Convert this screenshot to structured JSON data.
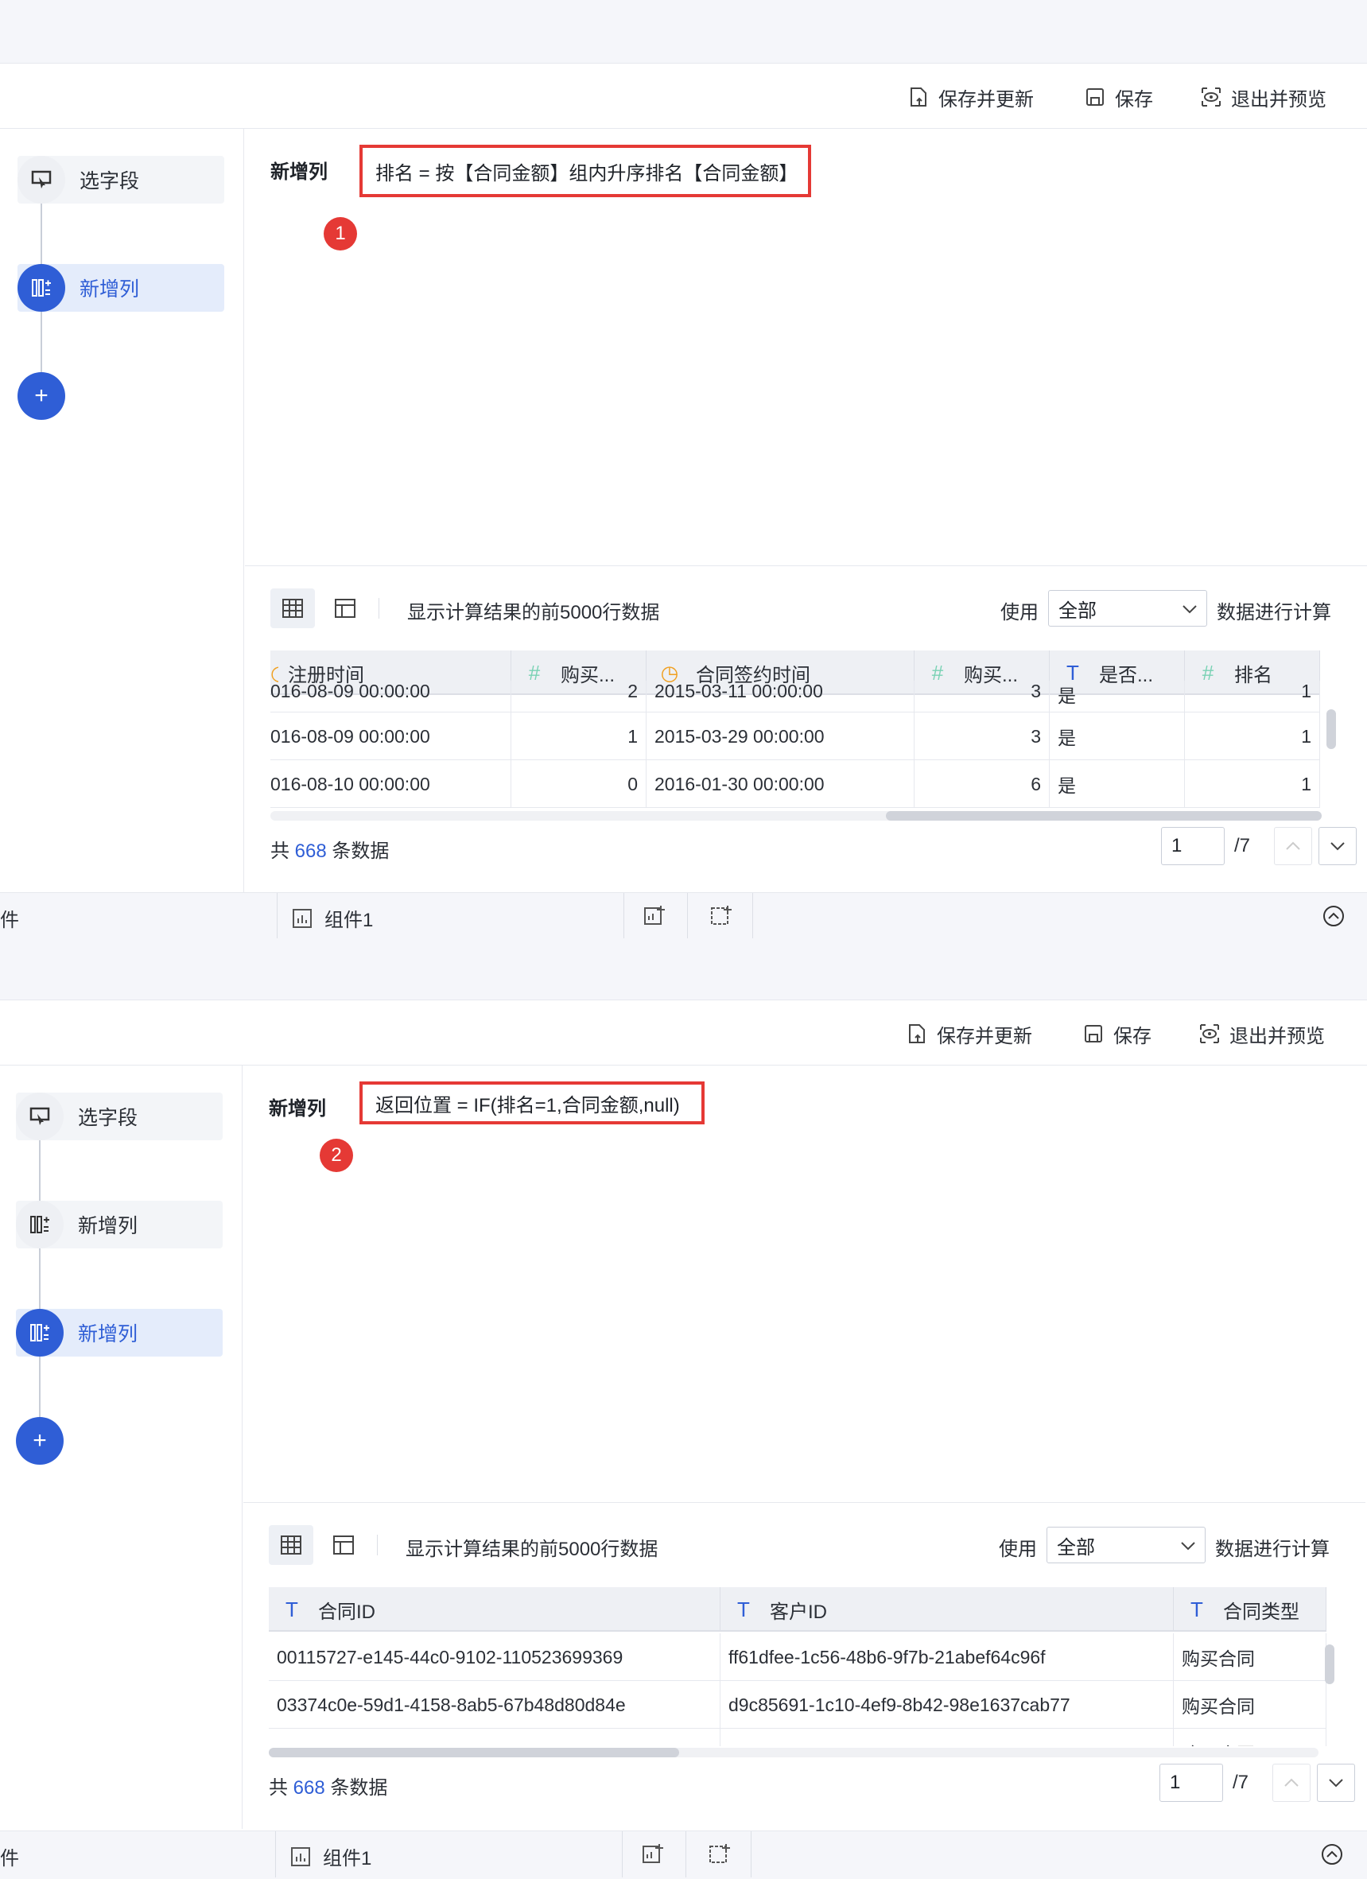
{
  "toolbar": {
    "save_update": "保存并更新",
    "save": "保存",
    "exit_preview": "退出并预览"
  },
  "steps": {
    "select_field": "选字段",
    "add_column": "新增列"
  },
  "editor": {
    "title": "新增列"
  },
  "preview": {
    "info": "显示计算结果的前5000行数据",
    "use_label": "使用",
    "scope_value": "全部",
    "calc_label": "数据进行计算",
    "footer_prefix": "共",
    "footer_count": "668",
    "footer_suffix": "条数据",
    "page_value": "1",
    "page_total": "/7"
  },
  "bottom": {
    "left_label": "件",
    "component": "组件1"
  },
  "panel1": {
    "formula": "排名 = 按【合同金额】组内升序排名【合同金额】",
    "badge": "1",
    "columns": [
      "注册时间",
      "购买...",
      "合同签约时间",
      "购买...",
      "是否...",
      "排名"
    ],
    "rows": [
      [
        "016-08-09 00:00:00",
        "2",
        "2015-03-11 00:00:00",
        "3",
        "是",
        "1"
      ],
      [
        "016-08-09 00:00:00",
        "1",
        "2015-03-29 00:00:00",
        "3",
        "是",
        "1"
      ],
      [
        "016-08-10 00:00:00",
        "0",
        "2016-01-30 00:00:00",
        "6",
        "是",
        "1"
      ]
    ]
  },
  "panel2": {
    "formula": "返回位置 = IF(排名=1,合同金额,null)",
    "badge": "2",
    "columns": [
      "合同ID",
      "客户ID",
      "合同类型"
    ],
    "rows": [
      [
        "00115727-e145-44c0-9102-110523699369",
        "ff61dfee-1c56-48b6-9f7b-21abef64c96f",
        "购买合同"
      ],
      [
        "03374c0e-59d1-4158-8ab5-67b48d80d84e",
        "d9c85691-1c10-4ef9-8b42-98e1637cab77",
        "购买合同"
      ],
      [
        "",
        "",
        "购买合同"
      ]
    ]
  },
  "colors": {
    "accent": "#2f5ed6",
    "highlight": "#e53935",
    "hash_icon": "#79d2b4",
    "clock_icon": "#f0a020",
    "text_icon": "#2f5ed6"
  },
  "icons": [
    "report-icon",
    "save-icon",
    "preview-eye-icon",
    "select-field-icon",
    "add-column-icon",
    "plus-icon",
    "table-view-icon",
    "layout-view-icon",
    "chevron-down-icon",
    "chevron-up-icon",
    "chart-icon",
    "add-component-icon",
    "add-widget-icon",
    "collapse-icon"
  ]
}
